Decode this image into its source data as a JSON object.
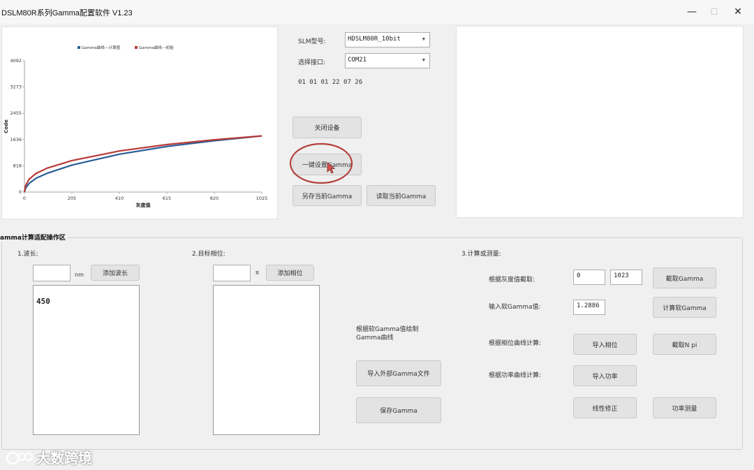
{
  "window": {
    "title": "DSLM80R系列Gamma配置软件 V1.23",
    "min_symbol": "—",
    "max_symbol": "☐",
    "close_symbol": "✕"
  },
  "chart_data": {
    "type": "line",
    "legend": [
      "Gamma曲线---计算值",
      "Gamma曲线---初始"
    ],
    "xlabel": "灰度值",
    "ylabel": "Code",
    "xticks": [
      "0",
      "205",
      "410",
      "615",
      "820",
      "1025"
    ],
    "yticks": [
      "0",
      "818",
      "1636",
      "2455",
      "3273",
      "4092"
    ],
    "xlim": [
      0,
      1025
    ],
    "ylim": [
      0,
      4092
    ],
    "legend_position": "top",
    "series": [
      {
        "name": "Gamma曲线---计算值",
        "color": "#2b5d96",
        "x": [
          0,
          5,
          20,
          50,
          100,
          205,
          410,
          615,
          820,
          1025
        ],
        "y": [
          0,
          120,
          270,
          430,
          590,
          840,
          1180,
          1420,
          1600,
          1750
        ]
      },
      {
        "name": "Gamma曲线---初始",
        "color": "#b83a3a",
        "x": [
          0,
          5,
          20,
          50,
          100,
          205,
          410,
          615,
          820,
          1025
        ],
        "y": [
          0,
          200,
          400,
          580,
          750,
          980,
          1280,
          1480,
          1630,
          1750
        ]
      }
    ]
  },
  "device": {
    "model_label": "SLM型号:",
    "model_value": "HDSLM80R_10bit",
    "port_label": "选择接口:",
    "port_value": "COM21",
    "hex_status": "01 01 01 22 07 26",
    "close_device": "关闭设备",
    "one_click_gamma": "一键设置Gamma",
    "save_current_gamma": "另存当前Gamma",
    "read_current_gamma": "读取当前Gamma"
  },
  "group": {
    "title": "amma计算适配操作区",
    "wavelength": {
      "label": "1.波长:",
      "unit": "nm",
      "add_button": "添加波长",
      "input_value": "",
      "items": [
        "450"
      ]
    },
    "phase": {
      "label": "2.目标相位:",
      "unit": "π",
      "add_button": "添加相位",
      "input_value": ""
    },
    "middle": {
      "draw_label": "根据软Gamma值绘制Gamma曲线",
      "import_external": "导入外部Gamma文件",
      "save_gamma": "保存Gamma"
    },
    "calc": {
      "label": "3.计算或测量:",
      "gray_label": "根据灰度值截取:",
      "gray_from": "0",
      "gray_to": "1023",
      "cut_gamma": "截取Gamma",
      "soft_gamma_label": "输入软Gamma值:",
      "soft_gamma_value": "1.2886",
      "calc_soft_gamma": "计算软Gamma",
      "phase_curve_label": "根据相位曲线计算:",
      "import_phase": "导入相位",
      "cut_npi": "截取N pi",
      "power_curve_label": "根据功率曲线计算:",
      "import_power": "导入功率",
      "linear_fix": "线性修正",
      "power_measure": "功率测量"
    }
  },
  "watermark": "大数跨境"
}
